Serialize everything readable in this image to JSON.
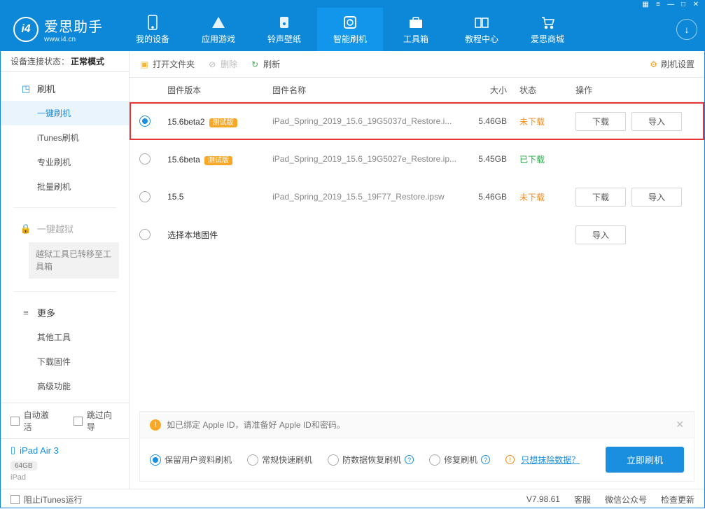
{
  "window": {
    "title": "爱思助手",
    "url": "www.i4.cn"
  },
  "nav": {
    "items": [
      {
        "label": "我的设备"
      },
      {
        "label": "应用游戏"
      },
      {
        "label": "铃声壁纸"
      },
      {
        "label": "智能刷机"
      },
      {
        "label": "工具箱"
      },
      {
        "label": "教程中心"
      },
      {
        "label": "爱思商城"
      }
    ]
  },
  "sidebar": {
    "conn_label": "设备连接状态：",
    "conn_value": "正常模式",
    "flash_head": "刷机",
    "flash_items": [
      "一键刷机",
      "iTunes刷机",
      "专业刷机",
      "批量刷机"
    ],
    "jailbreak_head": "一键越狱",
    "jailbreak_note": "越狱工具已转移至工具箱",
    "more_head": "更多",
    "more_items": [
      "其他工具",
      "下载固件",
      "高级功能"
    ],
    "auto_activate": "自动激活",
    "skip_wizard": "跳过向导",
    "device_name": "iPad Air 3",
    "device_storage": "64GB",
    "device_model": "iPad"
  },
  "toolbar": {
    "open": "打开文件夹",
    "delete": "删除",
    "refresh": "刷新",
    "settings": "刷机设置"
  },
  "table": {
    "headers": {
      "version": "固件版本",
      "name": "固件名称",
      "size": "大小",
      "status": "状态",
      "ops": "操作"
    },
    "beta_badge": "测试版",
    "rows": [
      {
        "selected": true,
        "version": "15.6beta2",
        "beta": true,
        "name": "iPad_Spring_2019_15.6_19G5037d_Restore.i...",
        "size": "5.46GB",
        "status": "未下载",
        "status_class": "nd",
        "ops": [
          "下载",
          "导入"
        ],
        "highlight": true
      },
      {
        "selected": false,
        "version": "15.6beta",
        "beta": true,
        "name": "iPad_Spring_2019_15.6_19G5027e_Restore.ip...",
        "size": "5.45GB",
        "status": "已下载",
        "status_class": "dl",
        "ops": []
      },
      {
        "selected": false,
        "version": "15.5",
        "beta": false,
        "name": "iPad_Spring_2019_15.5_19F77_Restore.ipsw",
        "size": "5.46GB",
        "status": "未下载",
        "status_class": "nd",
        "ops": [
          "下载",
          "导入"
        ]
      },
      {
        "selected": false,
        "version": "选择本地固件",
        "beta": false,
        "name": "",
        "size": "",
        "status": "",
        "status_class": "",
        "ops": [
          "导入"
        ]
      }
    ]
  },
  "alert": {
    "text": "如已绑定 Apple ID，请准备好 Apple ID和密码。"
  },
  "options": {
    "items": [
      "保留用户资料刷机",
      "常规快速刷机",
      "防数据恢复刷机",
      "修复刷机"
    ],
    "erase_label": "只想抹除数据？",
    "flash_now": "立即刷机"
  },
  "footer": {
    "block_itunes": "阻止iTunes运行",
    "version": "V7.98.61",
    "service": "客服",
    "wechat": "微信公众号",
    "update": "检查更新"
  }
}
